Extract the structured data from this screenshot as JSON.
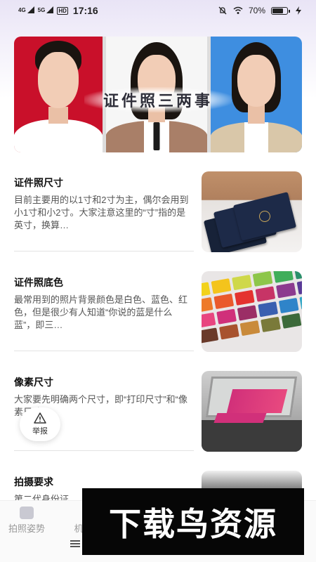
{
  "status_bar": {
    "signal_1": "4G",
    "signal_2": "5G",
    "hd": "HD",
    "time": "17:16",
    "battery": "70%"
  },
  "banner": {
    "title": "证件照三两事"
  },
  "articles": [
    {
      "title": "证件照尺寸",
      "description": "目前主要用的以1寸和2寸为主，偶尔会用到小1寸和小2寸。大家注意这里的“寸”指的是英寸，换算…"
    },
    {
      "title": "证件照底色",
      "description": "最常用到的照片背景颜色是白色、蓝色、红色，但是很少有人知道“你说的蓝是什么蓝”，即三…"
    },
    {
      "title": "像素尺寸",
      "description": "大家要先明确两个尺寸，即“打印尺寸”和“像素尺寸”。"
    },
    {
      "title": "拍摄要求",
      "description": "第二代身份证…"
    }
  ],
  "report_button": {
    "label": "举报"
  },
  "tabbar": {
    "tabs": [
      {
        "label": "拍照姿势",
        "icon": "photo-pose-icon"
      },
      {
        "label": "机",
        "icon": "camera-icon"
      }
    ]
  },
  "watermark": {
    "text": "下载鸟资源"
  },
  "colors": {
    "banner_red_bg": "#c9102a",
    "banner_blue_bg": "#3e8ee0",
    "swatches": [
      "#f2d21b",
      "#f4c41c",
      "#cfd84a",
      "#8dc64a",
      "#3fae5a",
      "#2a8f6a",
      "#ee7a2a",
      "#ea5a2c",
      "#e4322f",
      "#c73466",
      "#8c3a8f",
      "#5a3a97",
      "#e8457f",
      "#d0307a",
      "#9b2e66",
      "#3a5fb0",
      "#2f84c9",
      "#31a6c6",
      "#6a3a2a",
      "#a8522e",
      "#c98a3a",
      "#7a7a3a",
      "#3c6a3a",
      "#1d3d6a"
    ]
  }
}
